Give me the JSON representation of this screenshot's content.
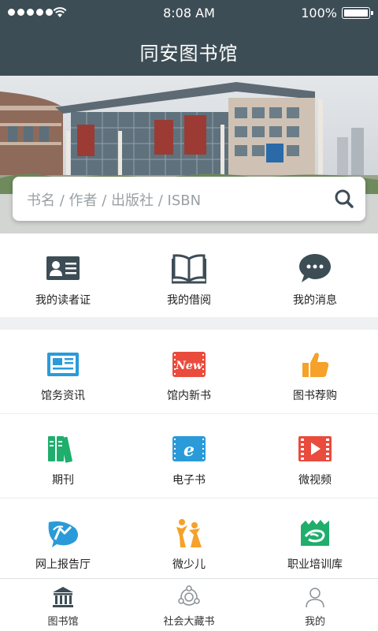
{
  "status_bar": {
    "time": "8:08 AM",
    "battery": "100%"
  },
  "header": {
    "title": "同安图书馆"
  },
  "search": {
    "placeholder": "书名 / 作者 / 出版社 / ISBN"
  },
  "quick_actions": [
    {
      "label": "我的读者证",
      "icon": "reader-card-icon"
    },
    {
      "label": "我的借阅",
      "icon": "open-book-icon"
    },
    {
      "label": "我的消息",
      "icon": "message-bubble-icon"
    }
  ],
  "grid": [
    {
      "label": "馆务资讯",
      "icon": "newspaper-icon"
    },
    {
      "label": "馆内新书",
      "icon": "new-badge-icon",
      "badge": "New"
    },
    {
      "label": "图书荐购",
      "icon": "thumbs-up-icon"
    },
    {
      "label": "期刊",
      "icon": "journals-icon"
    },
    {
      "label": "电子书",
      "icon": "ebook-icon",
      "badge": "e"
    },
    {
      "label": "微视频",
      "icon": "video-icon"
    },
    {
      "label": "网上报告厅",
      "icon": "lecture-hall-icon"
    },
    {
      "label": "微少儿",
      "icon": "children-icon"
    },
    {
      "label": "职业培训库",
      "icon": "vocational-training-icon"
    }
  ],
  "tab_bar": [
    {
      "label": "图书馆",
      "icon": "library-icon",
      "active": true
    },
    {
      "label": "社会大藏书",
      "icon": "community-collection-icon",
      "active": false
    },
    {
      "label": "我的",
      "icon": "user-icon",
      "active": false
    }
  ],
  "colors": {
    "header_bg": "#3d4d55",
    "icon_dark": "#3d4d55",
    "blue": "#2a9bd8",
    "red": "#e94b3c",
    "orange": "#f5a12a",
    "green": "#1fae6c",
    "divider": "#eff0f2"
  }
}
